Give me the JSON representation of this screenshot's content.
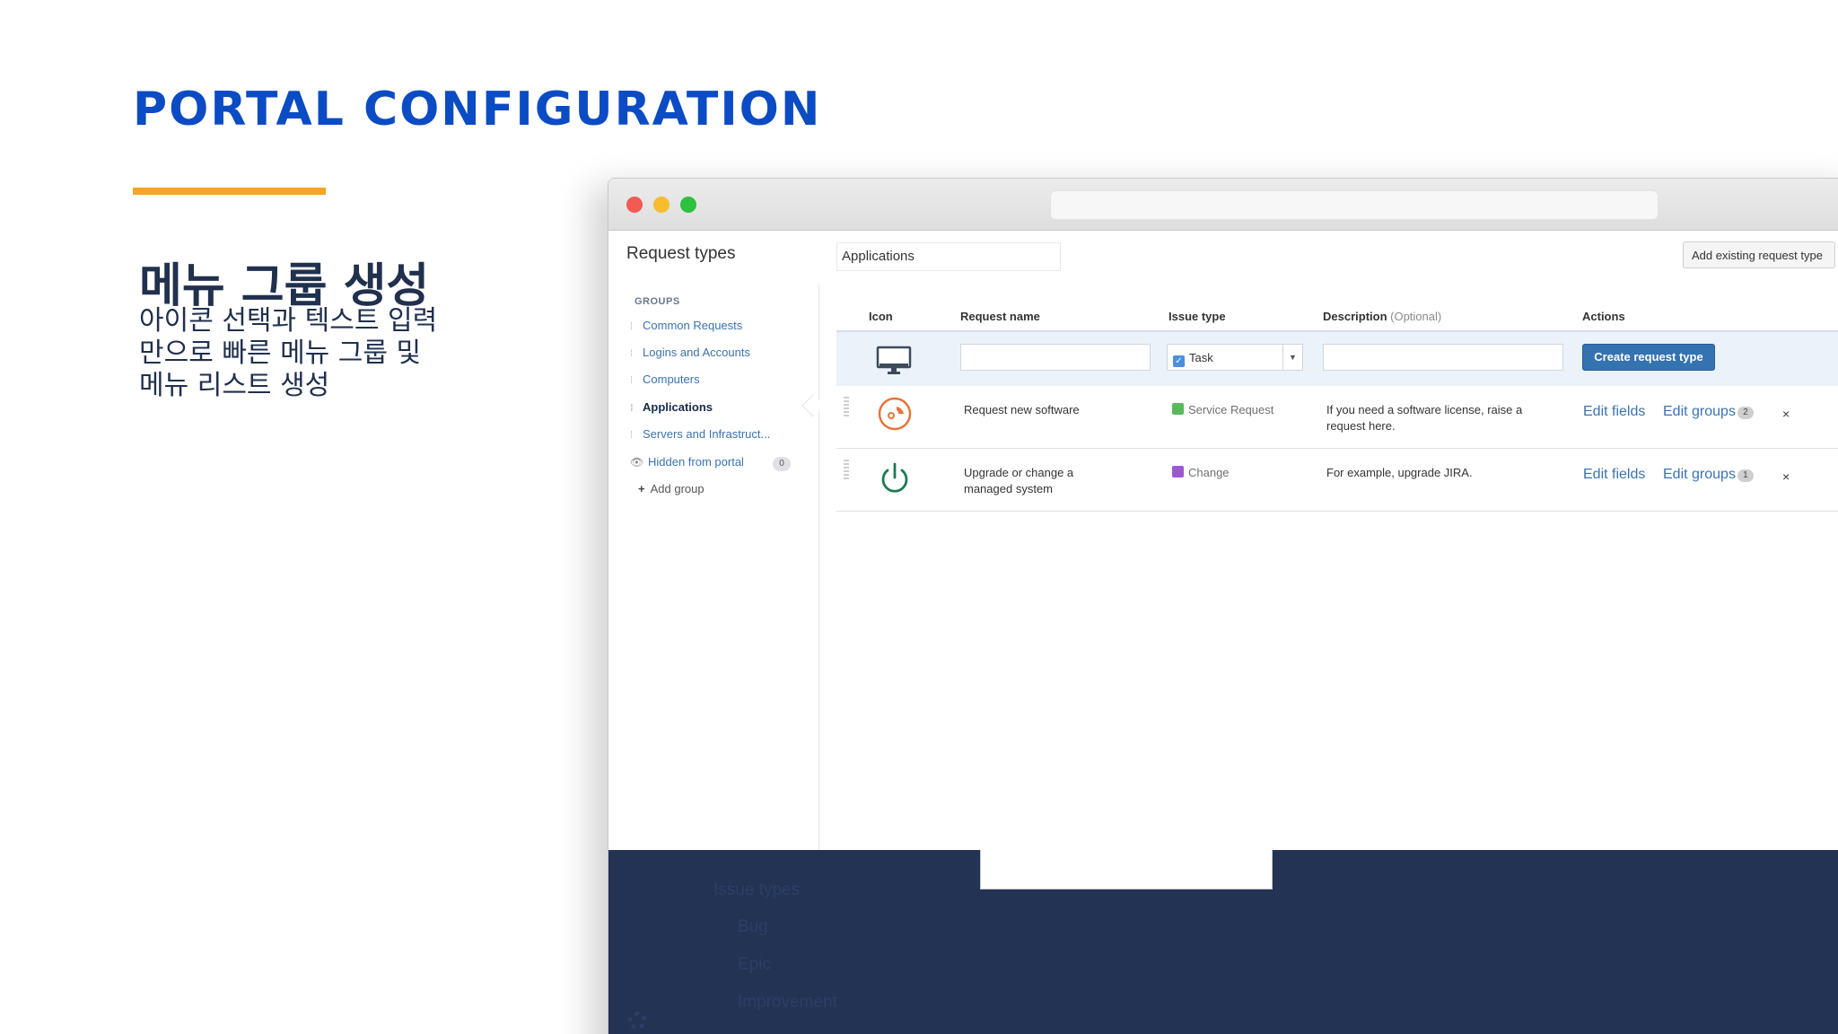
{
  "slide": {
    "title": "PORTAL CONFIGURATION",
    "heading": "메뉴 그룹 생성",
    "description_lines": [
      "아이콘 선택과 텍스트 입력",
      "만으로 빠른 메뉴 그룹 및",
      "메뉴 리스트 생성"
    ],
    "accent_color": "#f5a623",
    "title_color": "#0b4bc4"
  },
  "browser": {
    "page_title": "Request types",
    "group_name_value": "Applications",
    "add_existing_label": "Add existing request type"
  },
  "sidebar": {
    "heading": "GROUPS",
    "groups": [
      {
        "label": "Common Requests"
      },
      {
        "label": "Logins and Accounts"
      },
      {
        "label": "Computers"
      },
      {
        "label": "Applications",
        "active": true
      },
      {
        "label": "Servers and Infrastruct..."
      }
    ],
    "hidden": {
      "label": "Hidden from portal",
      "count": "0"
    },
    "add_group_label": "Add group"
  },
  "table": {
    "headers": {
      "icon": "Icon",
      "request_name": "Request name",
      "issue_type": "Issue type",
      "description": "Description",
      "description_note": "(Optional)",
      "actions": "Actions"
    },
    "create_row": {
      "icon": "monitor-icon",
      "issue_type_value": "Task",
      "create_button_label": "Create request type"
    },
    "rows": [
      {
        "icon": "software-disc-icon",
        "name": "Request new software",
        "issue_type": "Service Request",
        "issue_type_color": "#5cb85c",
        "description": "If you need a software license, raise a request here.",
        "edit_fields_label": "Edit fields",
        "edit_groups_label": "Edit groups",
        "groups_count": "2",
        "delete_label": "×"
      },
      {
        "icon": "power-icon",
        "name": "Upgrade or change a managed system",
        "issue_type": "Change",
        "issue_type_color": "#9b59d0",
        "description": "For example, upgrade JIRA.",
        "edit_fields_label": "Edit fields",
        "edit_groups_label": "Edit groups",
        "groups_count": "1",
        "delete_label": "×"
      }
    ]
  },
  "overlay": {
    "heading": "Issue types",
    "items": [
      "Bug",
      "Epic",
      "Improvement"
    ]
  }
}
